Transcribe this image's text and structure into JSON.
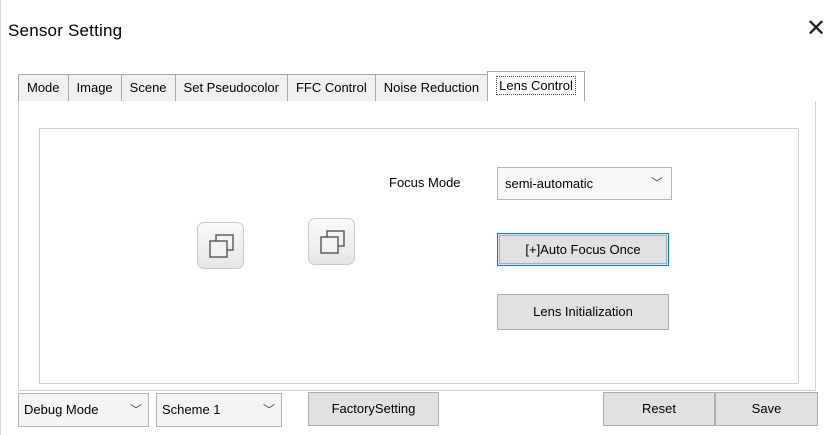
{
  "window": {
    "title": "Sensor Setting",
    "close_glyph": "✕"
  },
  "tabs": [
    {
      "label": "Mode"
    },
    {
      "label": "Image"
    },
    {
      "label": "Scene"
    },
    {
      "label": "Set Pseudocolor"
    },
    {
      "label": "FFC Control"
    },
    {
      "label": "Noise Reduction"
    },
    {
      "label": "Lens Control",
      "active": true
    }
  ],
  "lens_control": {
    "focus_mode_label": "Focus Mode",
    "focus_mode_value": "semi-automatic",
    "auto_focus_once_label": "[+]Auto Focus Once",
    "lens_initialization_label": "Lens Initialization",
    "icon_buttons": [
      "restore-window-icon",
      "restore-window-icon"
    ]
  },
  "bottom_bar": {
    "debug_mode_value": "Debug Mode",
    "scheme_value": "Scheme 1",
    "factory_setting_label": "FactorySetting",
    "reset_label": "Reset",
    "save_label": "Save"
  },
  "colors": {
    "focus_border": "#0078d7",
    "button_bg": "#e1e1e1"
  }
}
